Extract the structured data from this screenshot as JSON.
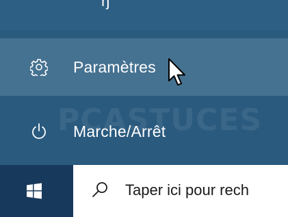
{
  "start_menu": {
    "partial_top_glyph": "ŋ",
    "items": [
      {
        "label": "Paramètres",
        "icon": "gear-icon",
        "hovered": true
      },
      {
        "label": "Marche/Arrêt",
        "icon": "power-icon",
        "hovered": false
      }
    ],
    "watermark": "PCASTUCES"
  },
  "taskbar": {
    "start_icon": "windows-logo-icon",
    "search": {
      "icon": "search-icon",
      "placeholder": "Taper ici pour rech"
    }
  },
  "colors": {
    "menu_bg": "#2a5a7e",
    "hover_bg": "#467291",
    "taskbar_bg": "#17395b",
    "search_bg": "#ffffff"
  }
}
